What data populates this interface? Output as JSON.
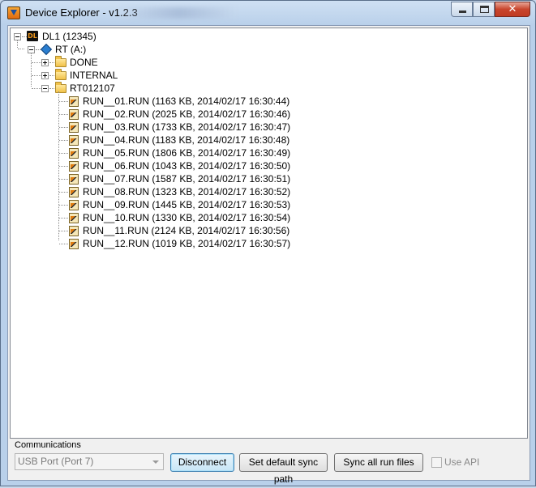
{
  "window": {
    "title": "Device Explorer - v1.2.3"
  },
  "tree": {
    "root": {
      "label": "DL1 (12345)",
      "icon": "datalogger-icon"
    },
    "drive": {
      "label": "RT (A:)",
      "icon": "drive-diamond-icon"
    },
    "folders": [
      {
        "label": "DONE",
        "expanded": false
      },
      {
        "label": "INTERNAL",
        "expanded": false
      },
      {
        "label": "RT012107",
        "expanded": true
      }
    ],
    "files": [
      {
        "label": "RUN__01.RUN (1163 KB, 2014/02/17 16:30:44)"
      },
      {
        "label": "RUN__02.RUN (2025 KB, 2014/02/17 16:30:46)"
      },
      {
        "label": "RUN__03.RUN (1733 KB, 2014/02/17 16:30:47)"
      },
      {
        "label": "RUN__04.RUN (1183 KB, 2014/02/17 16:30:48)"
      },
      {
        "label": "RUN__05.RUN (1806 KB, 2014/02/17 16:30:49)"
      },
      {
        "label": "RUN__06.RUN (1043 KB, 2014/02/17 16:30:50)"
      },
      {
        "label": "RUN__07.RUN (1587 KB, 2014/02/17 16:30:51)"
      },
      {
        "label": "RUN__08.RUN (1323 KB, 2014/02/17 16:30:52)"
      },
      {
        "label": "RUN__09.RUN (1445 KB, 2014/02/17 16:30:53)"
      },
      {
        "label": "RUN__10.RUN (1330 KB, 2014/02/17 16:30:54)"
      },
      {
        "label": "RUN__11.RUN (2124 KB, 2014/02/17 16:30:56)"
      },
      {
        "label": "RUN__12.RUN (1019 KB, 2014/02/17 16:30:57)"
      }
    ]
  },
  "communications": {
    "group_label": "Communications",
    "port_value": "USB Port (Port 7)",
    "disconnect_label": "Disconnect",
    "set_sync_path_label": "Set default sync path",
    "sync_all_label": "Sync all run files",
    "use_api_label": "Use API",
    "use_api_checked": false
  },
  "colors": {
    "accent_orange": "#f39a1e",
    "drive_blue": "#2a7ed0",
    "close_red": "#c8442c"
  }
}
